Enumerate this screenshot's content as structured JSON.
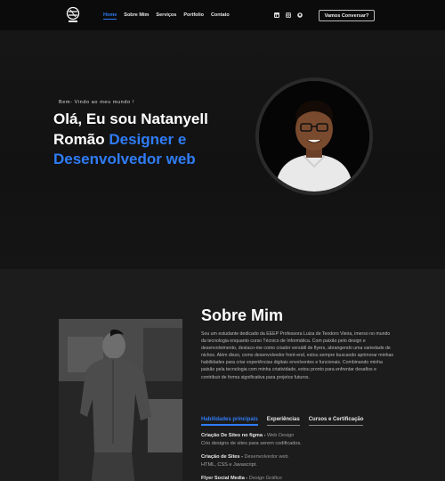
{
  "nav": {
    "menu": [
      "Home",
      "Sobre Mim",
      "Serviços",
      "Portfolio",
      "Contato"
    ],
    "active_index": 0,
    "social_icons": [
      "linkedin-icon",
      "instagram-icon",
      "github-icon"
    ],
    "cta_label": "Vamos Conversar?"
  },
  "hero": {
    "tagline": "Bem- Vindo ao meu mundo !",
    "headline_line1": "Olá, Eu sou Natanyell",
    "headline_name_end": "Romão",
    "headline_blue1": "Designer e",
    "headline_blue2": "Desenvolvedor web"
  },
  "about": {
    "title": "Sobre Mim",
    "text": "Sou um estudante dedicado da EEEP Professora Luiza de Teodoro Vieira, imerso no mundo da tecnologia enquanto curso Técnico de Informática. Com paixão pelo design e desenvolvimento, destaco-me como criador versátil de flyers, abrangendo uma variedade de nichos. Além disso, como desenvolvedor front-end, estou sempre buscando aprimorar minhas habilidades para criar experiências digitais envolventes e funcionais. Combinando minha paixão pela tecnologia com minha criatividade, estou pronto para enfrentar desafios e contribuir de forma significativa para projetos futuros.",
    "tabs": [
      "Habilidades principais",
      "Experiências",
      "Cursos e Certificação"
    ],
    "active_tab": 0,
    "skills": [
      {
        "name": "Criação De Sites no figma",
        "category": "Web Design",
        "desc": "Crio designs de sites para serem codificados."
      },
      {
        "name": "Criação de Sites",
        "category": "Desenvolvedor web",
        "desc": "HTML, CSS e Javascript."
      },
      {
        "name": "Flyer Social Media",
        "category": "Design Gráfico",
        "desc": ""
      }
    ]
  },
  "colors": {
    "accent": "#2f7cf6",
    "background": "#1b1b1b",
    "nav": "#0b0b0b"
  }
}
